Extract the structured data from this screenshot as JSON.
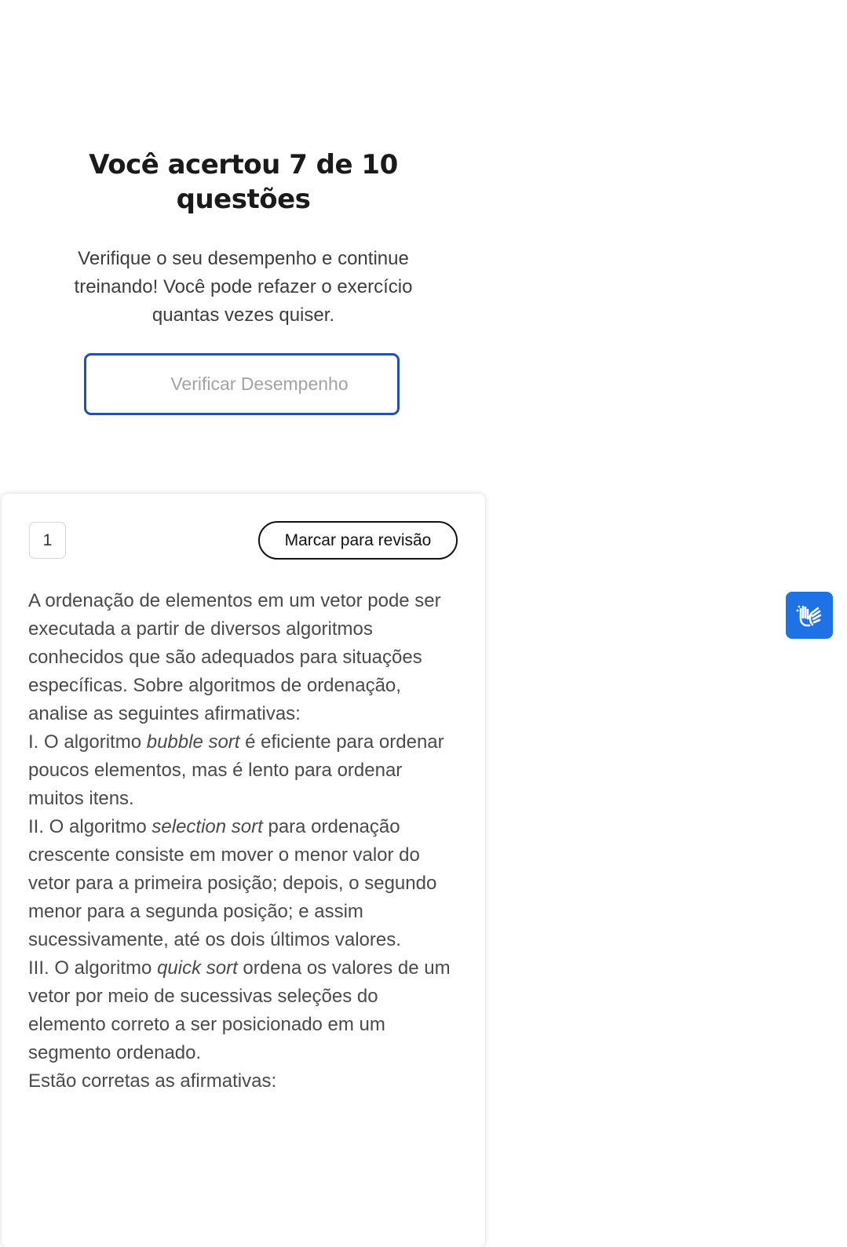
{
  "result": {
    "title": "Você acertou 7 de 10 questões",
    "subtitle": "Verifique o seu desempenho e continue treinando! Você pode refazer o exercício quantas vezes quiser.",
    "verify_button_label": "Verificar Desempenho"
  },
  "question": {
    "number": "1",
    "review_button_label": "Marcar para revisão",
    "intro": "A ordenação de elementos em um vetor pode ser executada a partir de diversos algoritmos conhecidos que são adequados para situações específicas. Sobre algoritmos de ordenação, analise as seguintes afirmativas:",
    "statements": [
      {
        "prefix": "I. O algoritmo ",
        "term": "bubble sort",
        "suffix": " é eficiente para ordenar poucos elementos, mas é lento para ordenar muitos itens."
      },
      {
        "prefix": "II. O algoritmo ",
        "term": "selection sort",
        "suffix": " para ordenação crescente consiste em mover o menor valor do vetor para a primeira posição; depois, o segundo menor para a segunda posição; e assim sucessivamente, até os dois últimos valores."
      },
      {
        "prefix": "III. O algoritmo ",
        "term": "quick sort",
        "suffix": " ordena os valores de um vetor por meio de sucessivas seleções do elemento correto a ser posicionado em um segmento ordenado."
      }
    ],
    "prompt": "Estão corretas as afirmativas:"
  },
  "accessibility": {
    "libras_icon": "sign-language-hands-icon",
    "libras_color": "#1f72e6"
  },
  "colors": {
    "button_border": "#1f4fbf",
    "button_text_disabled": "#a3a3a3",
    "title_text": "#1a1a1a",
    "body_text": "#4a4a4a"
  }
}
